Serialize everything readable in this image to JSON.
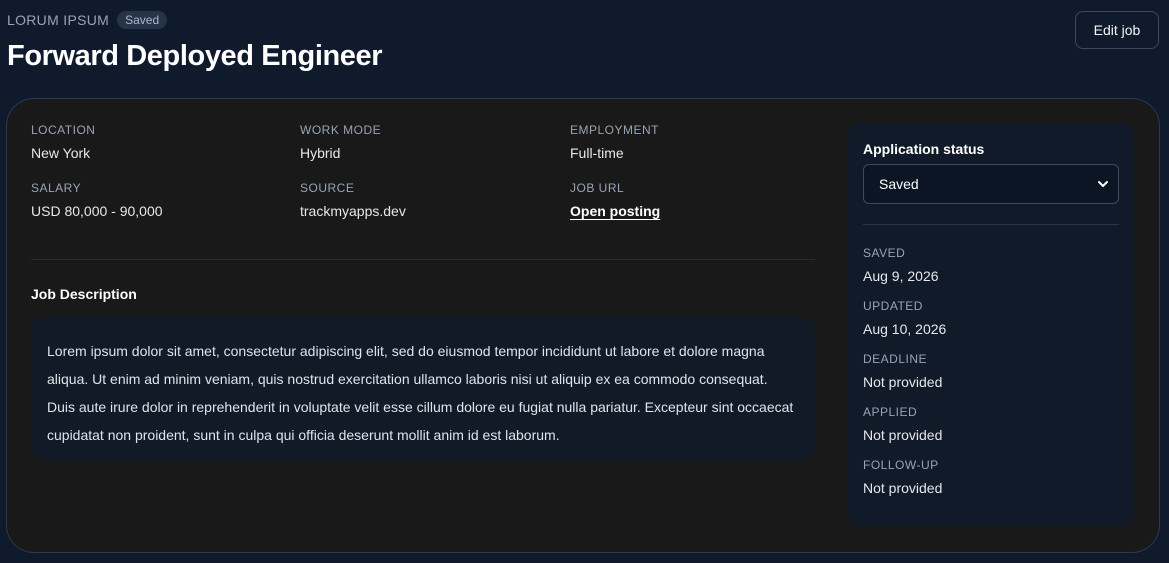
{
  "header": {
    "company": "LORUM IPSUM",
    "badge": "Saved",
    "title": "Forward Deployed Engineer",
    "edit_label": "Edit job"
  },
  "details": {
    "location": {
      "label": "LOCATION",
      "value": "New York"
    },
    "work_mode": {
      "label": "WORK MODE",
      "value": "Hybrid"
    },
    "employment": {
      "label": "EMPLOYMENT",
      "value": "Full-time"
    },
    "salary": {
      "label": "SALARY",
      "value": "USD 80,000 - 90,000"
    },
    "source": {
      "label": "SOURCE",
      "value": "trackmyapps.dev"
    },
    "job_url": {
      "label": "JOB URL",
      "value": "Open posting"
    }
  },
  "description": {
    "heading": "Job Description",
    "text": "Lorem ipsum dolor sit amet, consectetur adipiscing elit, sed do eiusmod tempor incididunt ut labore et dolore magna aliqua. Ut enim ad minim veniam, quis nostrud exercitation ullamco laboris nisi ut aliquip ex ea commodo consequat. Duis aute irure dolor in reprehenderit in voluptate velit esse cillum dolore eu fugiat nulla pariatur. Excepteur sint occaecat cupidatat non proident, sunt in culpa qui officia deserunt mollit anim id est laborum."
  },
  "status_panel": {
    "label": "Application status",
    "selected": "Saved",
    "saved": {
      "label": "SAVED",
      "value": "Aug 9, 2026"
    },
    "updated": {
      "label": "UPDATED",
      "value": "Aug 10, 2026"
    },
    "deadline": {
      "label": "DEADLINE",
      "value": "Not provided"
    },
    "applied": {
      "label": "APPLIED",
      "value": "Not provided"
    },
    "follow_up": {
      "label": "FOLLOW-UP",
      "value": "Not provided"
    }
  },
  "colors": {
    "page_bg": "#0f1b2d",
    "card_bg": "#191919",
    "panel_bg": "#111a29",
    "muted_text": "#9aa3b2"
  },
  "icons": {
    "select_chevron": "chevron-down-icon"
  }
}
